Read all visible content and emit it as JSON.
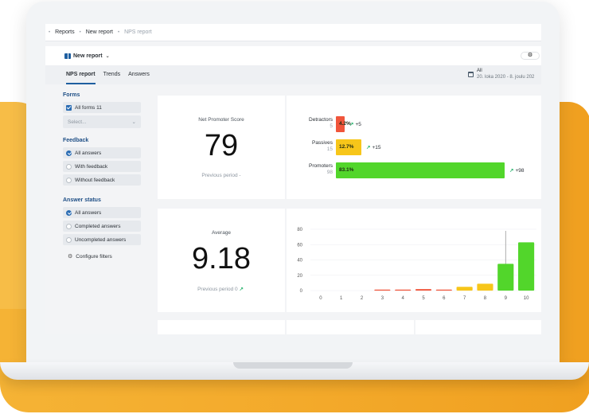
{
  "breadcrumb": [
    "Reports",
    "New report",
    "NPS report"
  ],
  "toolbar": {
    "report_name": "New report",
    "settings_icon": "gear-icon"
  },
  "tabs": [
    {
      "label": "NPS report",
      "active": true
    },
    {
      "label": "Trends",
      "active": false
    },
    {
      "label": "Answers",
      "active": false
    }
  ],
  "date_range": {
    "label": "All",
    "range": "20. loka 2020 - 8. joulu 202"
  },
  "sidebar": {
    "forms": {
      "title": "Forms",
      "all_forms": "All forms 11",
      "select_placeholder": "Select..."
    },
    "feedback": {
      "title": "Feedback",
      "options": [
        "All answers",
        "With feedback",
        "Without feedback"
      ],
      "selected": 0
    },
    "answer_status": {
      "title": "Answer status",
      "options": [
        "All answers",
        "Completed answers",
        "Uncompleted answers"
      ],
      "selected": 0
    },
    "configure": "Configure filters"
  },
  "nps_card": {
    "title": "Net Promoter Score",
    "value": "79",
    "previous": "Previous period -",
    "rows": [
      {
        "name": "Detractors",
        "count": "5",
        "percent_label": "4.2%",
        "percent": 4.2,
        "delta": "+5",
        "color": "#f0553b"
      },
      {
        "name": "Passives",
        "count": "15",
        "percent_label": "12.7%",
        "percent": 12.7,
        "delta": "+15",
        "color": "#f7c61a"
      },
      {
        "name": "Promoters",
        "count": "98",
        "percent_label": "83.1%",
        "percent": 83.1,
        "delta": "+98",
        "color": "#52d62b"
      }
    ]
  },
  "average_card": {
    "title": "Average",
    "value": "9.18",
    "previous": "Previous period 0"
  },
  "chart_data": {
    "type": "bar",
    "categories": [
      "0",
      "1",
      "2",
      "3",
      "4",
      "5",
      "6",
      "7",
      "8",
      "9",
      "10"
    ],
    "values": [
      0,
      0,
      0,
      1,
      1,
      2,
      1,
      5,
      9,
      35,
      63
    ],
    "colors": [
      "#f0553b",
      "#f0553b",
      "#f0553b",
      "#f0553b",
      "#f0553b",
      "#f0553b",
      "#f0553b",
      "#f7c61a",
      "#f7c61a",
      "#52d62b",
      "#52d62b"
    ],
    "ylim": [
      0,
      80
    ],
    "yticks": [
      0,
      20,
      40,
      60,
      80
    ],
    "xlabel": "",
    "ylabel": "",
    "marker_category": "9"
  }
}
